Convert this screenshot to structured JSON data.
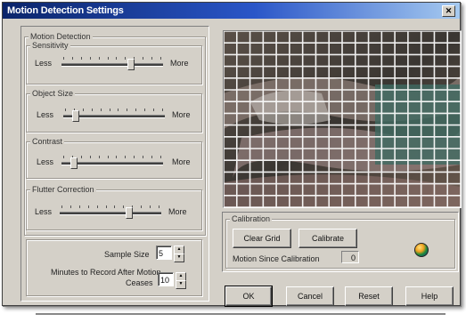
{
  "window": {
    "title": "Motion Detection Settings",
    "close_glyph": "✕"
  },
  "motion_detection": {
    "group_label": "Motion Detection",
    "sensitivity": {
      "label": "Sensitivity",
      "less": "Less",
      "more": "More",
      "value": 0.68
    },
    "object_size": {
      "label": "Object Size",
      "less": "Less",
      "more": "More",
      "value": 0.1
    },
    "contrast": {
      "label": "Contrast",
      "less": "Less",
      "more": "More",
      "value": 0.1
    },
    "flutter_correction": {
      "label": "Flutter Correction",
      "less": "Less",
      "more": "More",
      "value": 0.68
    }
  },
  "recording": {
    "sample_size_label": "Sample Size",
    "sample_size_value": "5",
    "minutes_label_line1": "Minutes to Record After Motion",
    "minutes_label_line2": "Ceases",
    "minutes_value": "10"
  },
  "calibration": {
    "group_label": "Calibration",
    "clear_grid": "Clear Grid",
    "calibrate": "Calibrate",
    "motion_since_label": "Motion Since Calibration",
    "motion_since_value": "0",
    "globe_icon": "globe-icon"
  },
  "buttons": {
    "ok": "OK",
    "cancel": "Cancel",
    "reset": "Reset",
    "help": "Help"
  },
  "preview": {
    "grid_cols": 18,
    "grid_rows": 15,
    "grid_color": "#ffffff"
  }
}
